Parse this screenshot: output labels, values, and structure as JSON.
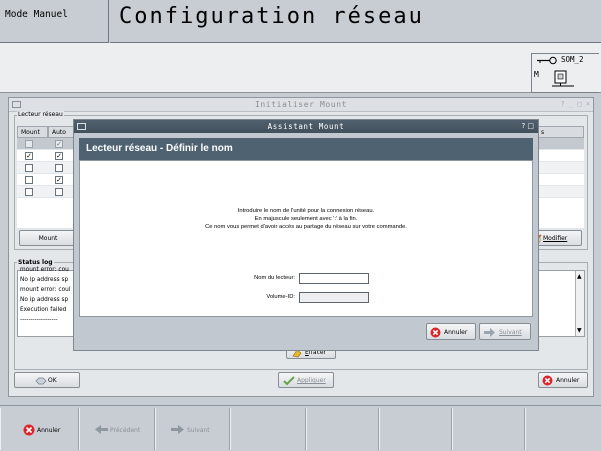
{
  "header": {
    "mode": "Mode Manuel",
    "title": "Configuration réseau",
    "som": "SOM_2",
    "m_label": "M"
  },
  "main_window": {
    "title": "Initialiser Mount",
    "lecteur_group": {
      "legend": "Lecteur réseau",
      "columns": [
        "Mount",
        "Auto",
        "s"
      ],
      "rows": [
        {
          "mount": false,
          "auto": true
        },
        {
          "mount": true,
          "auto": true
        },
        {
          "mount": false,
          "auto": false
        },
        {
          "mount": false,
          "auto": true
        },
        {
          "mount": false,
          "auto": false
        }
      ],
      "mount_button": "Mount",
      "modifier_button": "Modifier"
    },
    "status_log": {
      "legend": "Status log",
      "lines": [
        "mount error: cou",
        "No ip address sp",
        "mount error: coul",
        "No ip address sp",
        "Execution failed",
        "------------------"
      ]
    },
    "effacer_button": "Effacer",
    "ok_button": "OK",
    "appliquer_button": "Appliquer",
    "annuler_button": "Annuler"
  },
  "wizard": {
    "title": "Assistant Mount",
    "header": "Lecteur réseau - Définir le nom",
    "intro_lines": [
      "Introduire le nom de l'unité pour la connexion réseau.",
      "En majuscule seulement avec ':' à la fin.",
      "Ce nom vous permet d'avoir accès au partage du réseau sur votre commande."
    ],
    "lecteur_label": "Nom du lecteur:",
    "lecteur_value": "",
    "volume_label": "Volume-ID:",
    "volume_value": "",
    "annuler_button": "Annuler",
    "suivant_button": "Suivant"
  },
  "softkeys": {
    "annuler": "Annuler",
    "precedent": "Précédent",
    "suivant": "Suivant"
  },
  "colors": {
    "wizard_header": "#4e6272",
    "cancel_red": "#d8262a",
    "disabled_text": "#8a9097"
  }
}
